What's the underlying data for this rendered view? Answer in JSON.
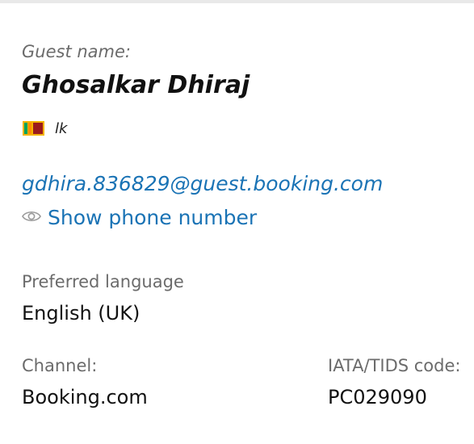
{
  "guest": {
    "label": "Guest name:",
    "name": "Ghosalkar Dhiraj",
    "country_code": "lk",
    "flag_icon": "sri-lanka-flag-icon",
    "email": "gdhira.836829@guest.booking.com",
    "show_phone_label": "Show phone number",
    "eye_icon": "eye-icon"
  },
  "preferences": {
    "language_label": "Preferred language",
    "language_value": "English (UK)"
  },
  "booking_source": {
    "channel_label": "Channel:",
    "channel_value": "Booking.com",
    "iata_label": "IATA/TIDS code:",
    "iata_value": "PC029090"
  },
  "colors": {
    "link": "#1a73b5",
    "label": "#6b6b6b",
    "text": "#111111"
  }
}
